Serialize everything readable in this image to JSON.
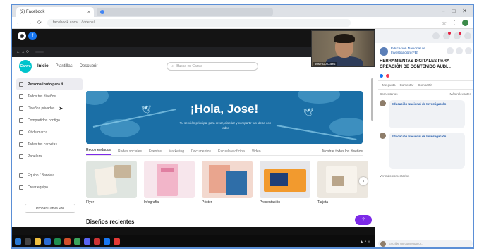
{
  "browser": {
    "tab_title": "(2) Facebook",
    "tab2_title": "",
    "address": "facebook.com/.../videos/...",
    "window_controls": [
      "–",
      "□",
      "✕"
    ]
  },
  "share_bar": {
    "inner_tab": "",
    "inner_address": ""
  },
  "webcam": {
    "name_label": "Jose Gonzalez"
  },
  "canva": {
    "logo": "Canva",
    "nav": [
      "Inicio",
      "Plantillas",
      "Descubrir"
    ],
    "search_placeholder": "Busca en Canva",
    "sidebar": [
      "Personalizado para ti",
      "Todos tus diseños",
      "Diseños privados",
      "Compartidos contigo",
      "Kit de marca",
      "Todas tus carpetas",
      "Papelera",
      "Equipo / Bandeja",
      "Crear equipo"
    ],
    "sidebar_button": "Probar Canva Pro",
    "hero_title": "¡Hola, Jose!",
    "hero_sub": "Tu sección principal para crear, diseñar y compartir tus ideas con todos",
    "tabs": [
      "Recomendados",
      "Redes sociales",
      "Eventos",
      "Marketing",
      "Documentos",
      "Escuela e oficina",
      "Video"
    ],
    "tabs_last": "Mostrar todos los diseños",
    "cards": [
      {
        "label": "Flyer",
        "sub": ""
      },
      {
        "label": "Infografía",
        "sub": ""
      },
      {
        "label": "Póster",
        "sub": ""
      },
      {
        "label": "Presentación",
        "sub": ""
      },
      {
        "label": "Tarjeta",
        "sub": ""
      }
    ],
    "recent": "Diseños recientes",
    "help": "?"
  },
  "facebook": {
    "page_name": "Educación Nacional de Investigación (FB)",
    "page_meta": "",
    "post_title": "HERRAMIENTAS DIGITALES PARA CREACIÓN DE CONTENIDO AUDI...",
    "reactions": "",
    "actions": [
      "Me gusta",
      "Comentar",
      "Compartir"
    ],
    "sort_left": "Comentarios",
    "sort_right": "Más relevantes",
    "comments": [
      {
        "name": "Educación Nacional de Investigación",
        "text": "",
        "meta": ""
      },
      {
        "name": "Educación Nacional de Investigación",
        "text": "",
        "meta": ""
      }
    ],
    "more": "Ver más comentarios",
    "write_placeholder": "Escribe un comentario..."
  },
  "colors": {
    "canva_teal": "#00c4cc",
    "canva_purple": "#7d2ae8",
    "hero_blue": "#1b6fa6",
    "facebook_blue": "#1877f2",
    "frame_border": "#5b8fd6"
  }
}
